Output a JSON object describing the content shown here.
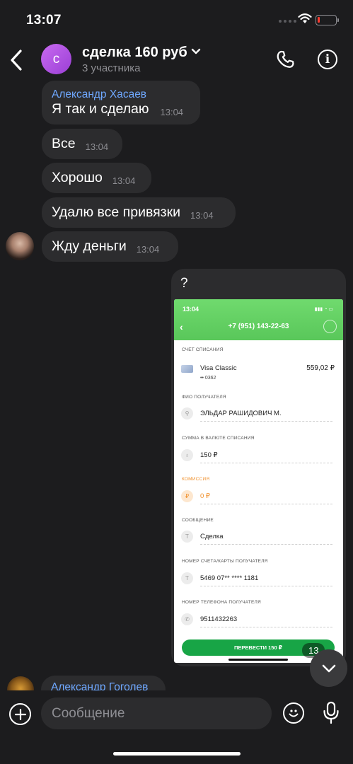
{
  "status_bar": {
    "time": "13:07"
  },
  "header": {
    "avatar_letter": "с",
    "title": "сделка 160 руб",
    "subtitle": "3 участника"
  },
  "messages": [
    {
      "sender": "Александр Хасаев",
      "text": "Я так и сделаю",
      "time": "13:04"
    },
    {
      "text": "Все",
      "time": "13:04"
    },
    {
      "text": "Хорошо",
      "time": "13:04"
    },
    {
      "text": "Удалю все привязки",
      "time": "13:04"
    },
    {
      "text": "Жду деньги",
      "time": "13:04"
    }
  ],
  "image_message": {
    "caption": "?",
    "time": "13",
    "screenshot": {
      "status_time": "13:04",
      "phone": "+7 (951) 143-22-63",
      "account_label": "СЧЕТ СПИСАНИЯ",
      "card_name": "Visa Classic",
      "card_number": "•• 0362",
      "card_amount": "559,02 ₽",
      "recipient_label": "ФИО ПОЛУЧАТЕЛЯ",
      "recipient": "ЭЛЬДАР РАШИДОВИЧ М.",
      "sum_label": "СУММА В ВАЛЮТЕ СПИСАНИЯ",
      "sum": "150 ₽",
      "fee_label": "КОМИССИЯ",
      "fee": "0 ₽",
      "message_label": "СООБЩЕНИЕ",
      "message": "Сделка",
      "card_no_label": "НОМЕР СЧЕТА/КАРТЫ ПОЛУЧАТЕЛЯ",
      "card_no": "5469 07** **** 1181",
      "phone_label": "НОМЕР ТЕЛЕФОНА ПОЛУЧАТЕЛЯ",
      "phone_value": "9511432263",
      "button": "ПЕРЕВЕСТИ 150 ₽"
    }
  },
  "partial_message": {
    "sender": "Александр Гоголев"
  },
  "composer": {
    "placeholder": "Сообщение"
  },
  "colors": {
    "background": "#1c1c1e",
    "bubble": "#2c2c2e",
    "sender": "#6fa8ff",
    "avatar": "#b553e6"
  }
}
